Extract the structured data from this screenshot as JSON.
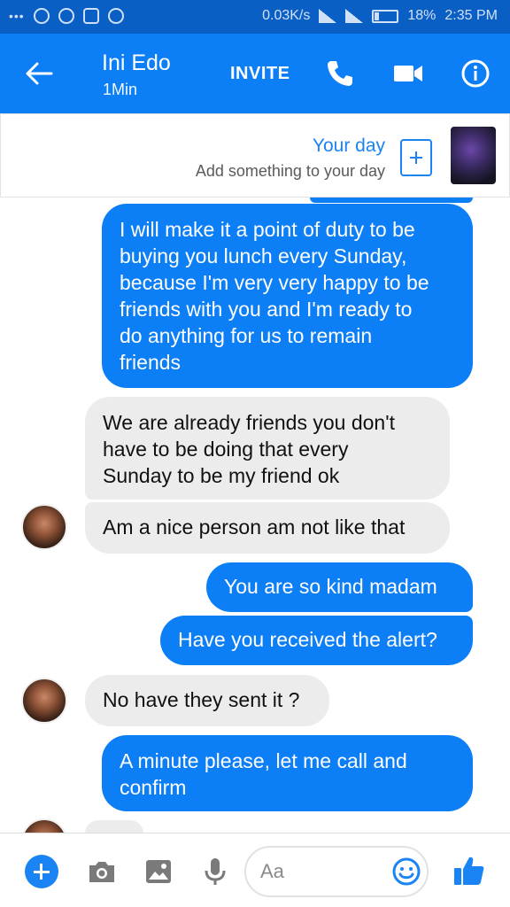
{
  "status_bar": {
    "left_icons": [
      "more-dots-icon",
      "person-icon",
      "whatsapp-icon",
      "image-icon",
      "app-icon"
    ],
    "speed": "0.03K/s",
    "battery": "18%",
    "time": "2:35 PM"
  },
  "header": {
    "contact_name": "Ini Edo",
    "contact_status": "1Min",
    "invite_label": "INVITE",
    "icons": [
      "back-arrow-icon",
      "phone-icon",
      "video-camera-icon",
      "info-icon"
    ]
  },
  "your_day": {
    "title": "Your day",
    "subtitle": "Add something to your day"
  },
  "messages": [
    {
      "direction": "outgoing",
      "lines": [
        "I will make it a point of duty to be",
        "buying you lunch every Sunday,",
        "because I'm very very happy to be",
        "friends with you and I'm ready to",
        "do anything for us to remain",
        "friends"
      ]
    },
    {
      "direction": "incoming",
      "lines": [
        "We are already friends you don't",
        "have to be doing that every",
        "Sunday to be my friend ok"
      ]
    },
    {
      "direction": "incoming",
      "lines": [
        "Am a nice person am not like that"
      ]
    },
    {
      "direction": "outgoing",
      "lines": [
        "You are so kind madam"
      ]
    },
    {
      "direction": "outgoing",
      "lines": [
        "Have you received the alert?"
      ]
    },
    {
      "direction": "incoming",
      "lines": [
        "No have they sent it ?"
      ]
    },
    {
      "direction": "outgoing",
      "lines": [
        "A minute please, let me call and",
        "confirm"
      ]
    }
  ],
  "composer": {
    "placeholder": "Aa",
    "icons": [
      "plus-icon",
      "camera-icon",
      "gallery-icon",
      "microphone-icon",
      "emoji-icon",
      "thumbs-up-icon"
    ]
  },
  "colors": {
    "brand_blue": "#0c7ef6",
    "status_bar_blue": "#0a5fc4",
    "incoming_bubble": "#ececec"
  }
}
